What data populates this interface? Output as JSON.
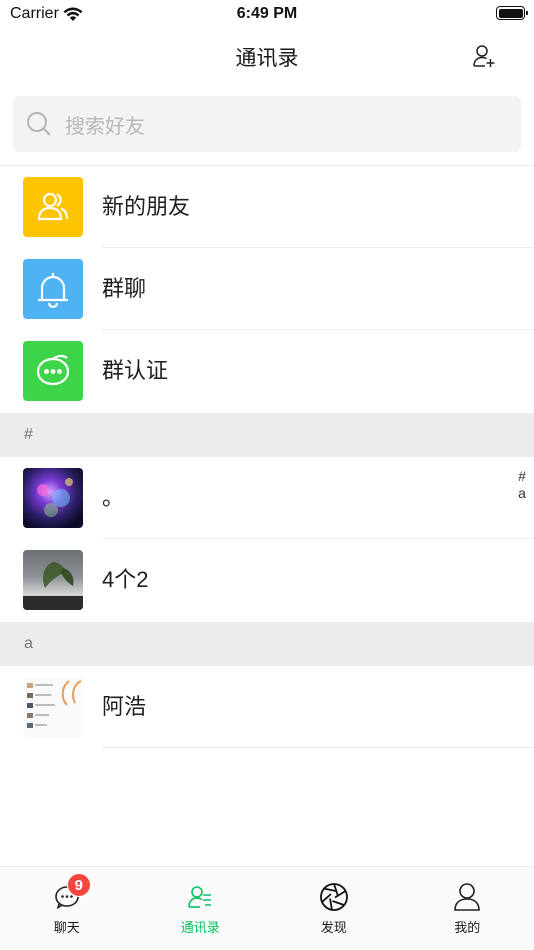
{
  "status_bar": {
    "carrier": "Carrier",
    "time": "6:49 PM"
  },
  "nav": {
    "title": "通讯录",
    "add_icon": "add-contact-icon"
  },
  "search": {
    "placeholder": "搜索好友"
  },
  "functions": [
    {
      "label": "新的朋友",
      "icon": "new-friends-icon",
      "color": "#fdc500"
    },
    {
      "label": "群聊",
      "icon": "bell-icon",
      "color": "#4fb2f2"
    },
    {
      "label": "群认证",
      "icon": "chat-bubble-icon",
      "color": "#3ed44a"
    }
  ],
  "sections": [
    {
      "header": "#",
      "contacts": [
        {
          "name": "。"
        },
        {
          "name": "4个2"
        }
      ]
    },
    {
      "header": "a",
      "contacts": [
        {
          "name": "阿浩"
        }
      ]
    }
  ],
  "index_letters": [
    "#",
    "a"
  ],
  "tabs": [
    {
      "label": "聊天",
      "icon": "chat-icon",
      "badge": "9",
      "active": false
    },
    {
      "label": "通讯录",
      "icon": "contacts-icon",
      "active": true
    },
    {
      "label": "发现",
      "icon": "discover-aperture-icon",
      "active": false
    },
    {
      "label": "我的",
      "icon": "profile-icon",
      "active": false
    }
  ],
  "colors": {
    "accent": "#08c160",
    "badge": "#f5453e",
    "section_bg": "#ececec"
  }
}
